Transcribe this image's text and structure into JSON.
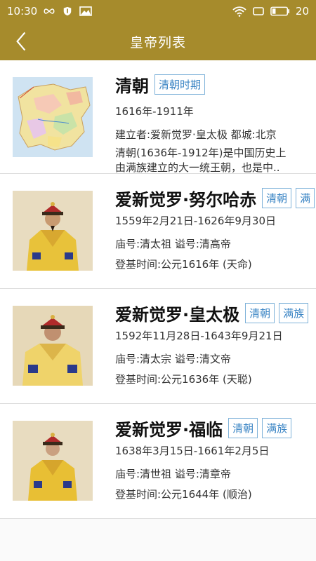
{
  "status_bar": {
    "time": "10:30",
    "battery": "20"
  },
  "nav": {
    "title": "皇帝列表"
  },
  "dynasty": {
    "name": "清朝",
    "tag": "清朝时期",
    "years": "1616年-1911年",
    "founder_capital": "建立者:爱新觉罗·皇太极  都城:北京",
    "desc_line1": "清朝(1636年-1912年)是中国历史上",
    "desc_line2": "由满族建立的大一统王朝，也是中.."
  },
  "emperors": [
    {
      "name": "爱新觉罗·努尔哈赤",
      "tag1": "清朝",
      "tag2": "满",
      "dates": "1559年2月21日-1626年9月30日",
      "titles": "庙号:清太祖 谥号:清高帝",
      "reign": "登基时间:公元1616年 (天命)"
    },
    {
      "name": "爱新觉罗·皇太极",
      "tag1": "清朝",
      "tag2": "满族",
      "dates": "1592年11月28日-1643年9月21日",
      "titles": "庙号:清太宗 谥号:清文帝",
      "reign": "登基时间:公元1636年 (天聪)"
    },
    {
      "name": "爱新觉罗·福临",
      "tag1": "清朝",
      "tag2": "满族",
      "dates": "1638年3月15日-1661年2月5日",
      "titles": "庙号:清世祖 谥号:清章帝",
      "reign": "登基时间:公元1644年 (顺治)"
    }
  ],
  "colors": {
    "header": "#a68b2c",
    "tag_border": "#7fb2d9",
    "tag_text": "#3a84c4"
  }
}
